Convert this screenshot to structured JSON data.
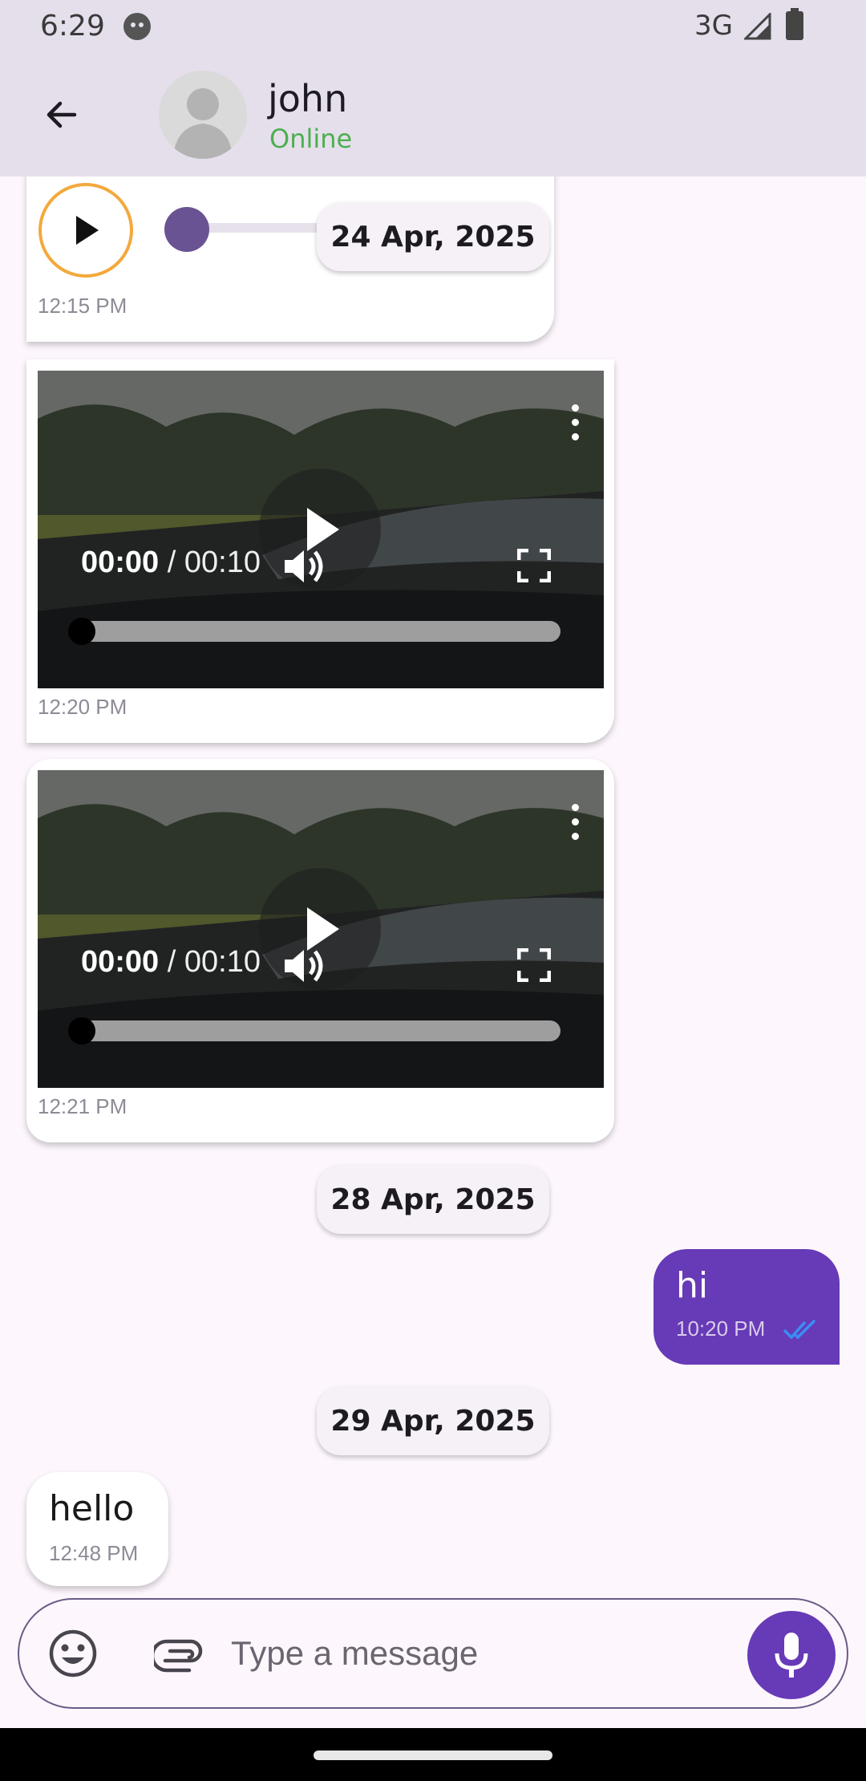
{
  "status_bar": {
    "time": "6:29",
    "network": "3G"
  },
  "header": {
    "contact_name": "john",
    "contact_status": "Online"
  },
  "messages": {
    "audio": {
      "time": "12:15 PM"
    },
    "video1": {
      "current": "00:00",
      "separator": " / ",
      "duration": "00:10",
      "time": "12:20 PM"
    },
    "video2": {
      "current": "00:00",
      "separator": " / ",
      "duration": "00:10",
      "time": "12:21 PM"
    },
    "date_chips": [
      "24 Apr, 2025",
      "28 Apr, 2025",
      "29 Apr, 2025"
    ],
    "outgoing_hi": {
      "text": "hi",
      "time": "10:20 PM"
    },
    "incoming_hello": {
      "text": "hello",
      "time": "12:48 PM"
    }
  },
  "composer": {
    "placeholder": "Type a message"
  },
  "colors": {
    "accent": "#673ab7",
    "online": "#4caf50",
    "read_ticks": "#3a8ef6",
    "audio_ring": "#f3a93c"
  },
  "icons": [
    "back-arrow-icon",
    "emoji-icon",
    "attach-icon",
    "mic-icon",
    "play-icon",
    "volume-icon",
    "fullscreen-icon",
    "more-vert-icon",
    "double-check-icon"
  ]
}
